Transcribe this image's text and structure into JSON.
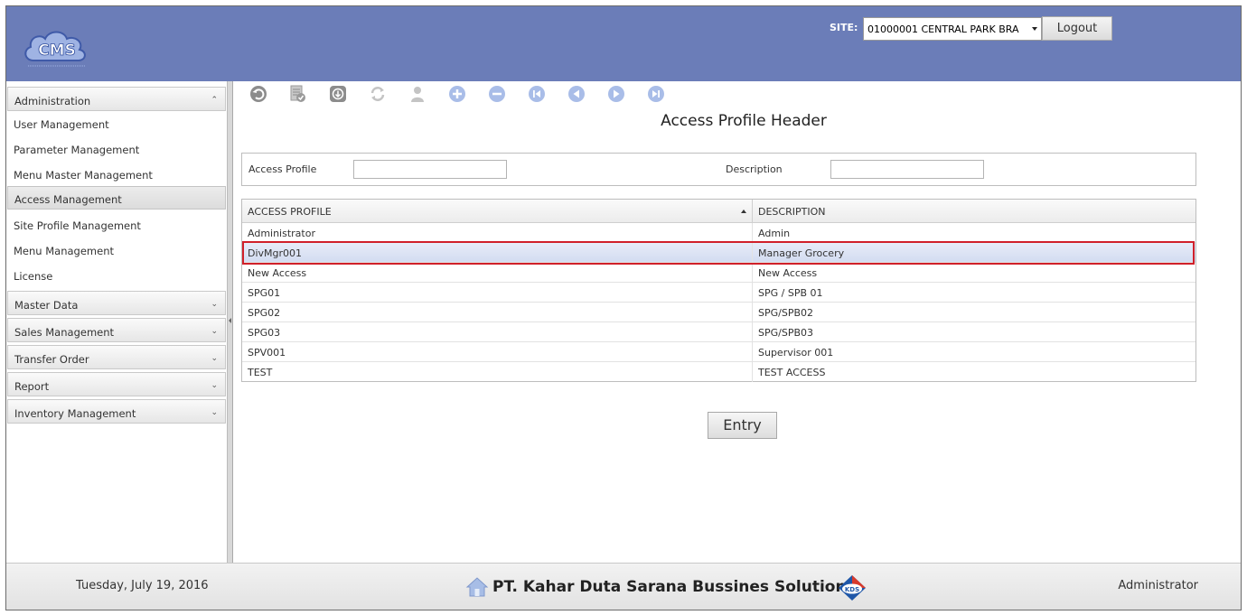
{
  "header": {
    "logo_text": "CMS",
    "site_label": "SITE:",
    "site_value": "01000001 CENTRAL PARK BRA",
    "logout_label": "Logout"
  },
  "sidebar": {
    "sections": [
      {
        "label": "Administration",
        "expanded": true,
        "items": [
          {
            "label": "User Management",
            "active": false
          },
          {
            "label": "Parameter Management",
            "active": false
          },
          {
            "label": "Menu Master Management",
            "active": false
          },
          {
            "label": "Access Management",
            "active": true
          },
          {
            "label": "Site Profile Management",
            "active": false
          },
          {
            "label": "Menu Management",
            "active": false
          },
          {
            "label": "License",
            "active": false
          }
        ]
      },
      {
        "label": "Master Data",
        "expanded": false
      },
      {
        "label": "Sales Management",
        "expanded": false
      },
      {
        "label": "Transfer Order",
        "expanded": false
      },
      {
        "label": "Report",
        "expanded": false
      },
      {
        "label": "Inventory Management",
        "expanded": false
      }
    ]
  },
  "toolbar": {
    "icons": [
      "undo-icon",
      "approve-document-icon",
      "download-icon",
      "refresh-icon",
      "user-icon",
      "add-icon",
      "remove-icon",
      "first-record-icon",
      "previous-record-icon",
      "next-record-icon",
      "last-record-icon"
    ]
  },
  "main": {
    "title": "Access Profile Header",
    "filter": {
      "access_profile_label": "Access Profile",
      "access_profile_value": "",
      "description_label": "Description",
      "description_value": ""
    },
    "grid": {
      "columns": [
        "ACCESS PROFILE",
        "DESCRIPTION"
      ],
      "rows": [
        {
          "profile": "Administrator",
          "description": "Admin",
          "selected": false
        },
        {
          "profile": "DivMgr001",
          "description": "Manager Grocery",
          "selected": true
        },
        {
          "profile": "New Access",
          "description": "New Access",
          "selected": false
        },
        {
          "profile": "SPG01",
          "description": "SPG / SPB 01",
          "selected": false
        },
        {
          "profile": "SPG02",
          "description": "SPG/SPB02",
          "selected": false
        },
        {
          "profile": "SPG03",
          "description": "SPG/SPB03",
          "selected": false
        },
        {
          "profile": "SPV001",
          "description": "Supervisor 001",
          "selected": false
        },
        {
          "profile": "TEST",
          "description": "TEST ACCESS",
          "selected": false
        }
      ]
    },
    "entry_label": "Entry"
  },
  "footer": {
    "date": "Tuesday, July 19, 2016",
    "company": "PT. Kahar Duta Sarana Bussines Solutions",
    "company_logo_text": "KDS",
    "user": "Administrator"
  },
  "colors": {
    "header_bg": "#6b7db8",
    "selection_border": "#d0202a",
    "selection_bg": "#dbe2f4"
  }
}
